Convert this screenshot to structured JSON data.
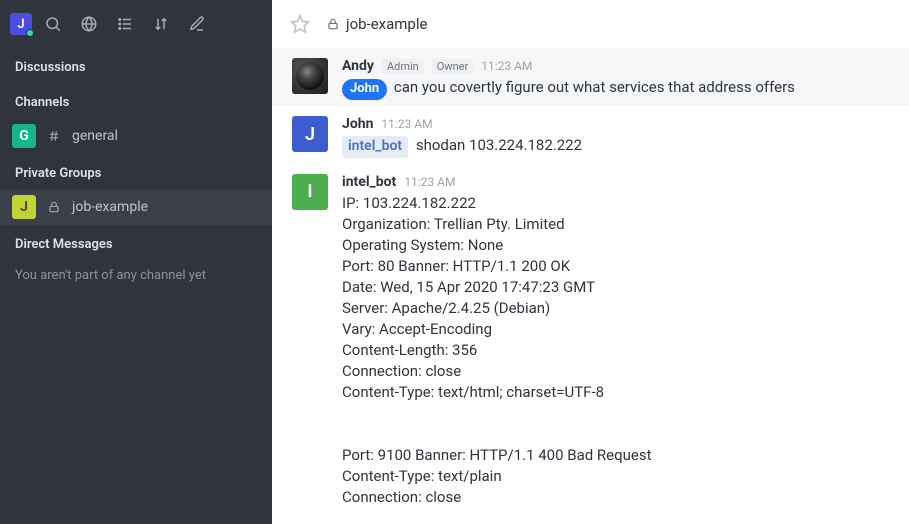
{
  "sidebar": {
    "user_initial": "J",
    "sections": {
      "discussions": "Discussions",
      "channels": "Channels",
      "private_groups": "Private Groups",
      "direct_messages": "Direct Messages"
    },
    "channels": [
      {
        "initial": "G",
        "name": "general",
        "color": "#12b886"
      }
    ],
    "private_groups": [
      {
        "initial": "J",
        "name": "job-example",
        "color": "#c0d332"
      }
    ],
    "dm_empty": "You aren't part of any channel yet"
  },
  "header": {
    "room_name": "job-example"
  },
  "roles": {
    "admin": "Admin",
    "owner": "Owner"
  },
  "messages": [
    {
      "user": "Andy",
      "time": "11:23 AM",
      "roles": [
        "admin",
        "owner"
      ],
      "avatar": {
        "type": "image"
      },
      "content": {
        "mention": "John",
        "text": "can you covertly figure out what services that address offers"
      }
    },
    {
      "user": "John",
      "time": "11:23 AM",
      "avatar": {
        "initial": "J",
        "color": "#3c5ccf"
      },
      "content": {
        "agent_mention": "intel_bot",
        "text": "shodan 103.224.182.222"
      }
    },
    {
      "user": "intel_bot",
      "time": "11:23 AM",
      "avatar": {
        "initial": "I",
        "color": "#4cae50"
      },
      "content": {
        "text": "IP: 103.224.182.222\nOrganization: Trellian Pty. Limited\nOperating System: None\nPort: 80 Banner: HTTP/1.1 200 OK\nDate: Wed, 15 Apr 2020 17:47:23 GMT\nServer: Apache/2.4.25 (Debian)\nVary: Accept-Encoding\nContent-Length: 356\nConnection: close\nContent-Type: text/html; charset=UTF-8\n\n\nPort: 9100 Banner: HTTP/1.1 400 Bad Request\nContent-Type: text/plain\nConnection: close"
      }
    }
  ]
}
